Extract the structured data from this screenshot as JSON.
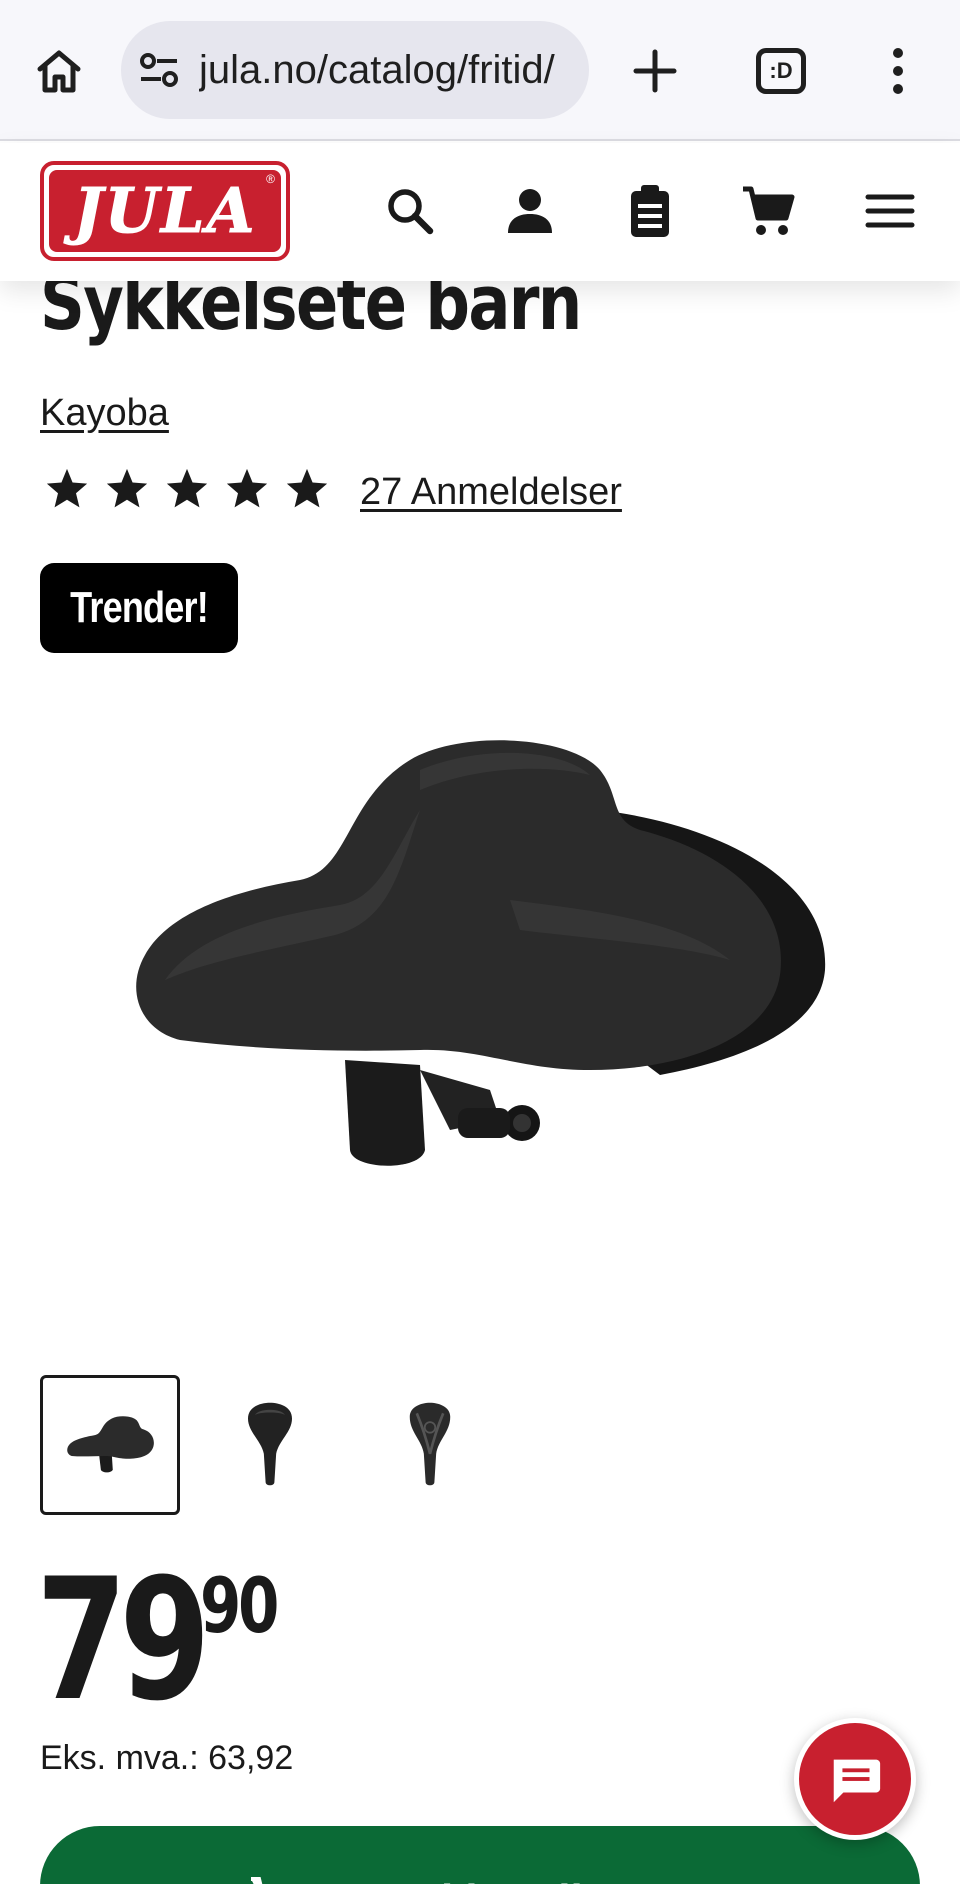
{
  "browser": {
    "url": "jula.no/catalog/fritid/",
    "tabs_label": ":D"
  },
  "header": {
    "logo_text": "JULA",
    "logo_reg": "®"
  },
  "product": {
    "title": "Sykkelsete barn",
    "brand": "Kayoba",
    "rating_stars": 5,
    "reviews": "27 Anmeldelser",
    "badge": "Trender!",
    "thumbnail_count": 3,
    "active_thumbnail": 1
  },
  "price": {
    "integer": "79",
    "decimal": "90",
    "vat_text": "Eks. mva.: 63,92"
  },
  "cart": {
    "label": "Legg i handlevogn"
  },
  "colors": {
    "brand_red": "#c8202f",
    "cart_green": "#0b6a36",
    "badge_black": "#000000"
  },
  "icons": [
    "home-icon",
    "tune-icon",
    "plus-icon",
    "tabs-icon",
    "more-vert-icon",
    "search-icon",
    "account-icon",
    "clipboard-icon",
    "cart-icon",
    "menu-icon",
    "star-icon",
    "chat-icon"
  ]
}
